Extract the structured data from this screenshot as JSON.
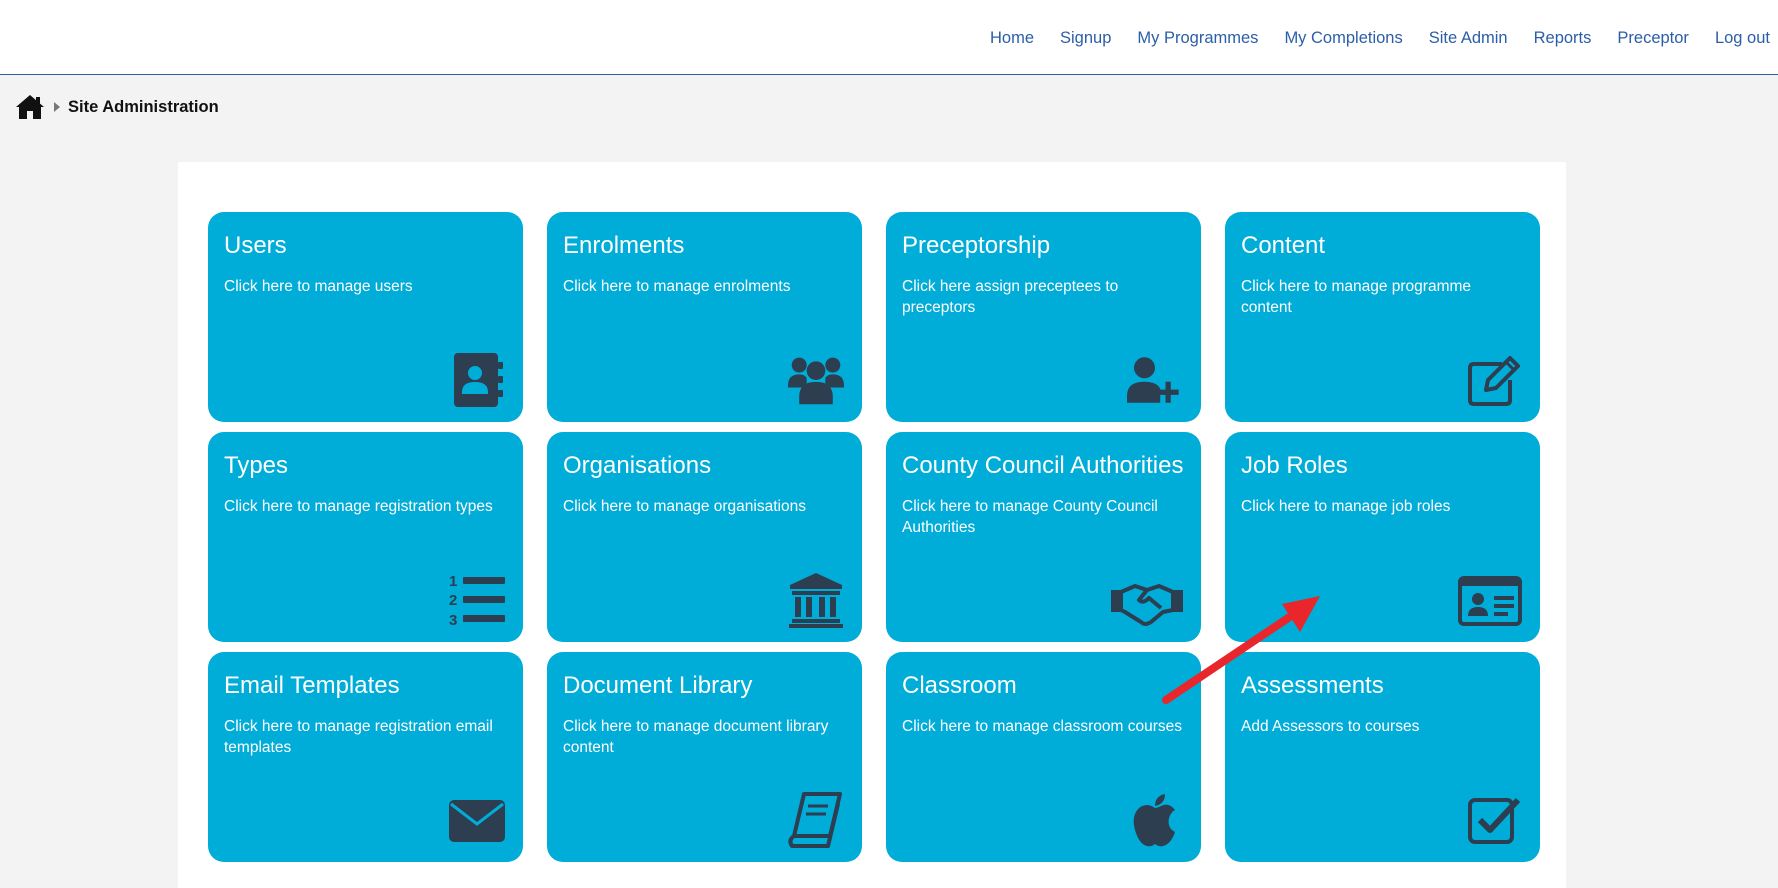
{
  "nav": {
    "items": [
      "Home",
      "Signup",
      "My Programmes",
      "My Completions",
      "Site Admin",
      "Reports",
      "Preceptor",
      "Log out"
    ]
  },
  "breadcrumb": {
    "home_icon": "home-icon",
    "separator_icon": "caret-right-icon",
    "current": "Site Administration"
  },
  "colors": {
    "tile_bg": "#00acd8",
    "icon_color": "#2c3e50",
    "nav_link": "#2b5ea8",
    "annotation_arrow": "#e8262b"
  },
  "tiles": [
    {
      "title": "Users",
      "desc": "Click here to manage users",
      "icon": "address-book-icon"
    },
    {
      "title": "Enrolments",
      "desc": "Click here to manage enrolments",
      "icon": "users-group-icon"
    },
    {
      "title": "Preceptorship",
      "desc": "Click here assign preceptees to preceptors",
      "icon": "user-plus-icon"
    },
    {
      "title": "Content",
      "desc": "Click here to manage programme content",
      "icon": "edit-icon"
    },
    {
      "title": "Types",
      "desc": "Click here to manage registration types",
      "icon": "numbered-list-icon"
    },
    {
      "title": "Organisations",
      "desc": "Click here to manage organisations",
      "icon": "institution-icon"
    },
    {
      "title": "County Council Authorities",
      "desc": "Click here to manage County Council Authorities",
      "icon": "handshake-icon"
    },
    {
      "title": "Job Roles",
      "desc": "Click here to manage job roles",
      "icon": "id-card-icon"
    },
    {
      "title": "Email Templates",
      "desc": "Click here to manage registration email templates",
      "icon": "envelope-icon"
    },
    {
      "title": "Document Library",
      "desc": "Click here to manage document library content",
      "icon": "book-icon"
    },
    {
      "title": "Classroom",
      "desc": "Click here to manage classroom courses",
      "icon": "apple-icon"
    },
    {
      "title": "Assessments",
      "desc": "Add Assessors to courses",
      "icon": "checkbox-icon"
    }
  ]
}
